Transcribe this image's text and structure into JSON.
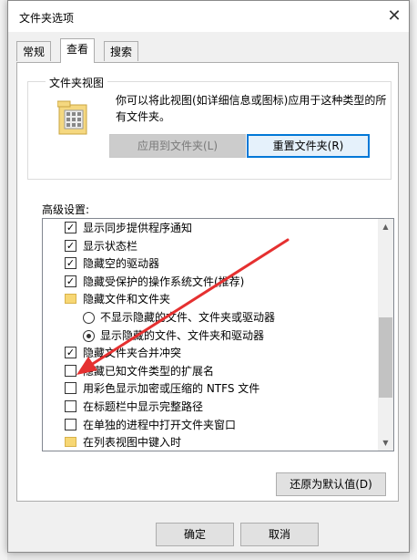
{
  "dialog": {
    "title": "文件夹选项"
  },
  "tabs": [
    {
      "label": "常规"
    },
    {
      "label": "查看"
    },
    {
      "label": "搜索"
    }
  ],
  "folder_views": {
    "group_title": "文件夹视图",
    "description": "你可以将此视图(如详细信息或图标)应用于这种类型的所有文件夹。",
    "apply_button": "应用到文件夹(L)",
    "reset_button": "重置文件夹(R)"
  },
  "advanced": {
    "label": "高级设置:",
    "items": [
      {
        "type": "checkbox",
        "checked": true,
        "label": "显示同步提供程序通知"
      },
      {
        "type": "checkbox",
        "checked": true,
        "label": "显示状态栏"
      },
      {
        "type": "checkbox",
        "checked": true,
        "label": "隐藏空的驱动器"
      },
      {
        "type": "checkbox",
        "checked": true,
        "label": "隐藏受保护的操作系统文件(推荐)"
      },
      {
        "type": "folder",
        "label": "隐藏文件和文件夹"
      },
      {
        "type": "radio",
        "checked": false,
        "label": "不显示隐藏的文件、文件夹或驱动器"
      },
      {
        "type": "radio",
        "checked": true,
        "label": "显示隐藏的文件、文件夹和驱动器"
      },
      {
        "type": "checkbox",
        "checked": true,
        "label": "隐藏文件夹合并冲突"
      },
      {
        "type": "checkbox",
        "checked": false,
        "label": "隐藏已知文件类型的扩展名"
      },
      {
        "type": "checkbox",
        "checked": false,
        "label": "用彩色显示加密或压缩的 NTFS 文件"
      },
      {
        "type": "checkbox",
        "checked": false,
        "label": "在标题栏中显示完整路径"
      },
      {
        "type": "checkbox",
        "checked": false,
        "label": "在单独的进程中打开文件夹窗口"
      },
      {
        "type": "folder",
        "label": "在列表视图中键入时"
      }
    ]
  },
  "restore_button": "还原为默认值(D)",
  "ok_button": "确定",
  "cancel_button": "取消",
  "colors": {
    "accent": "#0078d7",
    "annotation_arrow": "#e53030"
  }
}
